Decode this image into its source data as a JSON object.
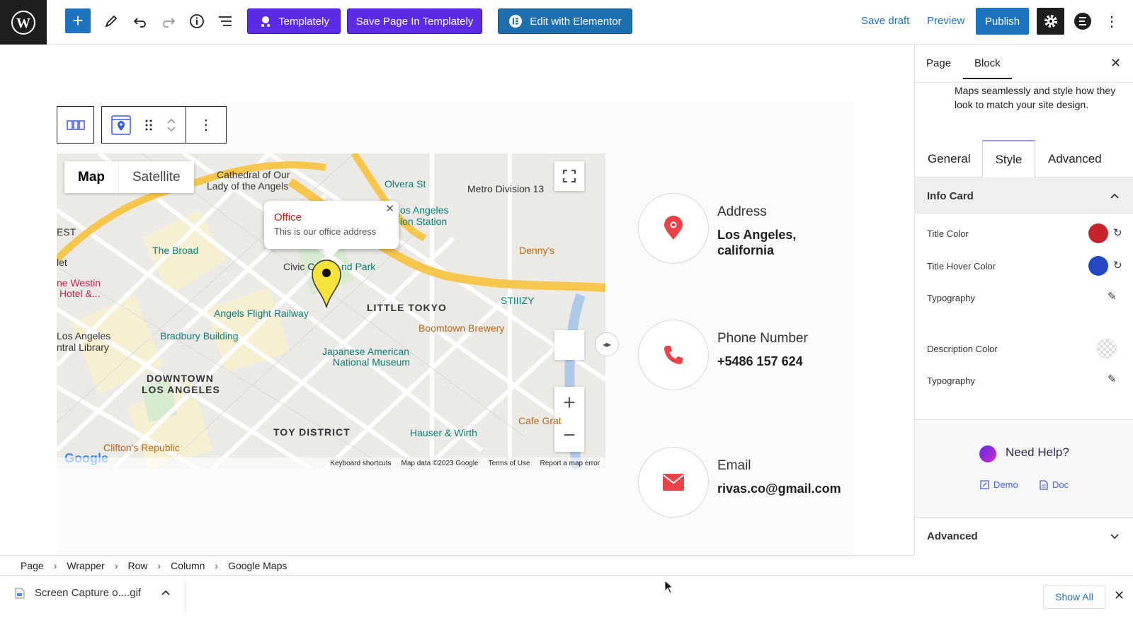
{
  "toolbar": {
    "templately_label": "Templately",
    "save_templately_label": "Save Page In Templately",
    "elementor_label": "Edit with Elementor",
    "save_draft_label": "Save draft",
    "preview_label": "Preview",
    "publish_label": "Publish"
  },
  "map": {
    "tab_map": "Map",
    "tab_satellite": "Satellite",
    "info_title": "Office",
    "info_desc": "This is our office address",
    "footer": {
      "shortcuts": "Keyboard shortcuts",
      "mapdata": "Map data ©2023 Google",
      "terms": "Terms of Use",
      "report": "Report a map error"
    },
    "labels": {
      "cathedral": "Cathedral of Our",
      "cathedral2": "Lady of the Angels",
      "olvera": "Olvera St",
      "metro": "Metro Division 13",
      "la_station": "os Angeles",
      "la_station2": "ion Station",
      "broad": "The Broad",
      "civic": "Civic C",
      "grand_park": "nd Park",
      "westin": "ne Westin",
      "westin2": "Hotel &...",
      "angels_flight": "Angels Flight Railway",
      "little_tokyo": "LITTLE TOKYO",
      "bradbury": "Bradbury Building",
      "library": "Los Angeles",
      "library2": "ntral Library",
      "japanese": "Japanese American",
      "japanese2": "National Museum",
      "boomtown": "Boomtown Brewery",
      "stiiizy": "STIIIZY",
      "dennys": "Denny's",
      "downtown": "DOWNTOWN",
      "downtown2": "LOS ANGELES",
      "toy_district": "TOY DISTRICT",
      "hauser": "Hauser & Wirth",
      "cafe": "Cafe Grat",
      "clifton": "Clifton's Republic",
      "est": "EST",
      "let": "let",
      "google": "Google"
    }
  },
  "cards": [
    {
      "title": "Address",
      "desc": "Los Angeles, california",
      "icon": "location-pin-icon"
    },
    {
      "title": "Phone Number",
      "desc": "+5486 157 624",
      "icon": "phone-icon"
    },
    {
      "title": "Email",
      "desc": "rivas.co@gmail.com",
      "icon": "envelope-icon"
    }
  ],
  "breadcrumb": [
    "Page",
    "Wrapper",
    "Row",
    "Column",
    "Google Maps"
  ],
  "sidebar": {
    "tab_page": "Page",
    "tab_block": "Block",
    "description": "Maps seamlessly and style how they look to match your site design.",
    "tab_general": "General",
    "tab_style": "Style",
    "tab_advanced": "Advanced",
    "section_info_card": "Info Card",
    "title_color": "Title Color",
    "title_hover_color": "Title Hover Color",
    "typography": "Typography",
    "description_color": "Description Color",
    "typography2": "Typography",
    "help_title": "Need Help?",
    "demo_label": "Demo",
    "doc_label": "Doc",
    "section_advanced": "Advanced"
  },
  "colors": {
    "title_color": "#c8232c",
    "title_hover_color": "#2449c2",
    "accent_blue": "#1e73be",
    "templately_purple": "#5b2ce3",
    "icon_red": "#e94248"
  },
  "downloads": {
    "file_name": "Screen Capture o....gif",
    "show_all": "Show All"
  }
}
